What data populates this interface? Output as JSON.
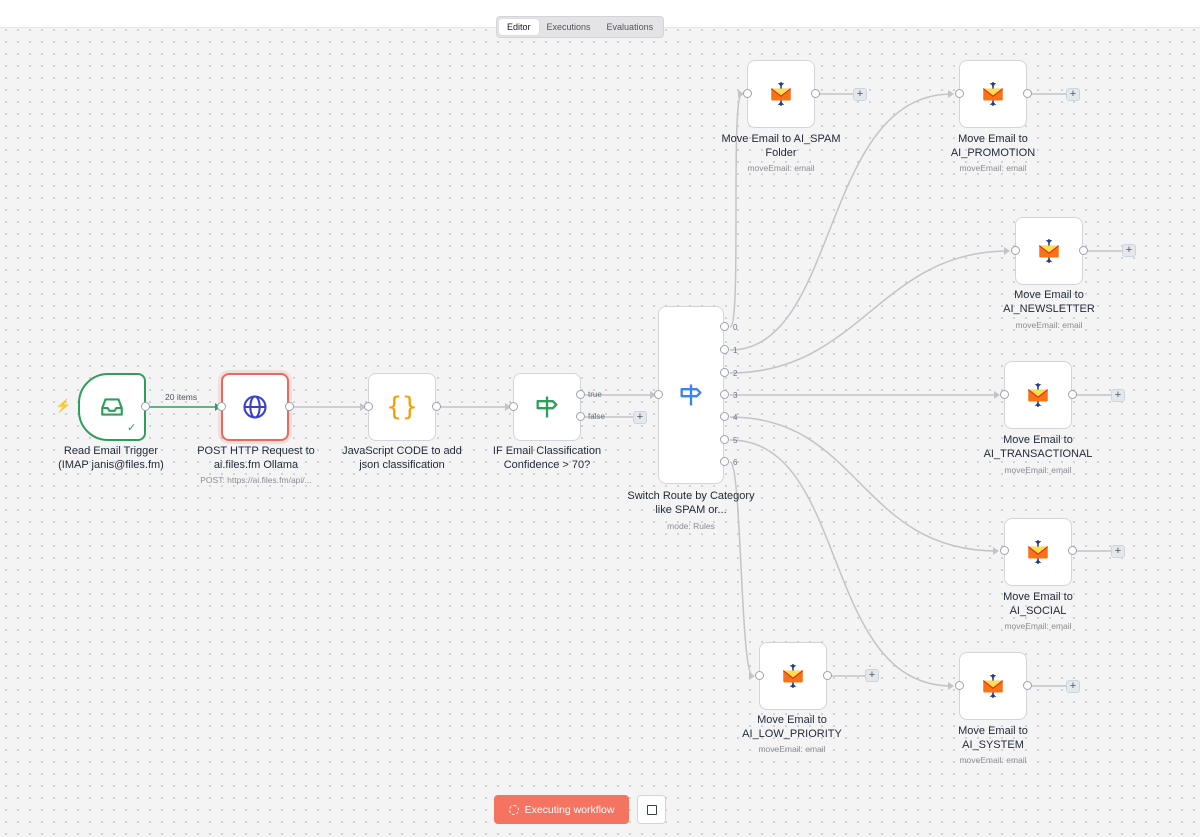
{
  "tabs": [
    "Editor",
    "Executions",
    "Evaluations"
  ],
  "nodes": {
    "trigger": {
      "label": "Read Email Trigger (IMAP janis@files.fm)"
    },
    "http": {
      "label": "POST HTTP Request to ai.files.fm Ollama",
      "sub": "POST: https://ai.files.fm/api/..."
    },
    "code": {
      "label": "JavaScript CODE to add json classification"
    },
    "if": {
      "label": "IF Email Classification Confidence > 70?",
      "true_label": "true",
      "false_label": "false"
    },
    "switch": {
      "label": "Switch Route by Category like SPAM or...",
      "sub": "mode: Rules",
      "outputs": [
        "0",
        "1",
        "2",
        "3",
        "4",
        "5",
        "6"
      ]
    },
    "spam": {
      "label": "Move Email to AI_SPAM Folder",
      "sub": "moveEmail: email"
    },
    "promotion": {
      "label": "Move Email to AI_PROMOTION",
      "sub": "moveEmail: email"
    },
    "newsletter": {
      "label": "Move Email to AI_NEWSLETTER",
      "sub": "moveEmail: email"
    },
    "transactional": {
      "label": "Move Email to AI_TRANSACTIONAL",
      "sub": "moveEmail: email"
    },
    "social": {
      "label": "Move Email to AI_SOCIAL",
      "sub": "moveEmail: email"
    },
    "low_priority": {
      "label": "Move Email to AI_LOW_PRIORITY",
      "sub": "moveEmail: email"
    },
    "system": {
      "label": "Move Email to AI_SYSTEM",
      "sub": "moveEmail: email"
    }
  },
  "edge_items": "20 items",
  "plus_symbol": "+",
  "execute_label": "Executing workflow",
  "colors": {
    "trigger": "#2f9e5b",
    "active": "#e96a5a",
    "execute": "#f47461"
  }
}
